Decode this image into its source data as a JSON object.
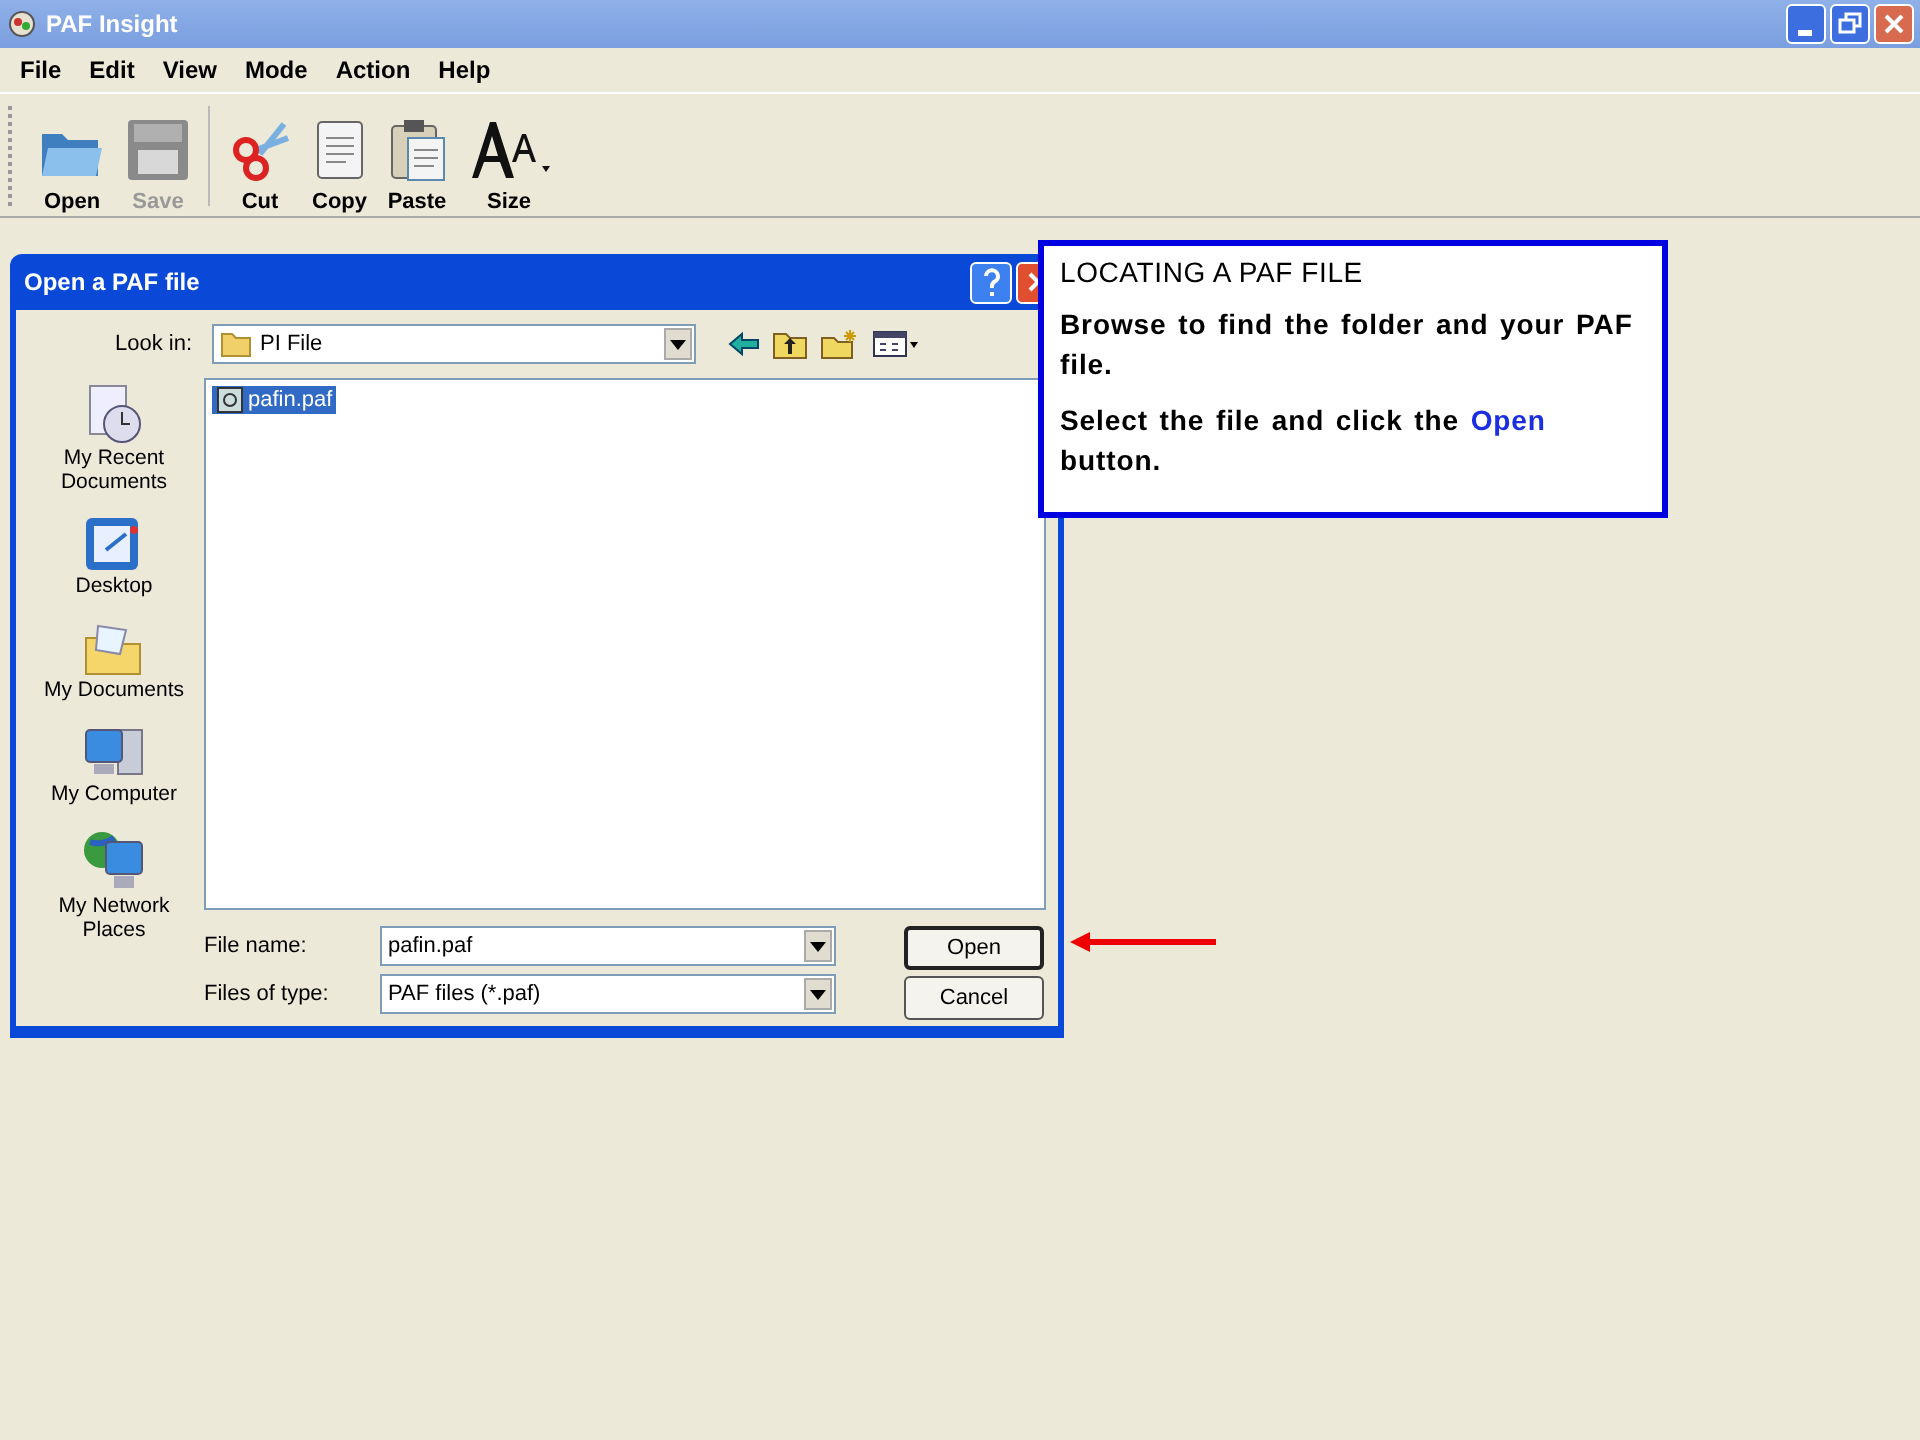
{
  "window": {
    "title": "PAF Insight"
  },
  "menu": [
    "File",
    "Edit",
    "View",
    "Mode",
    "Action",
    "Help"
  ],
  "toolbar": [
    {
      "label": "Open",
      "kind": "open",
      "disabled": false
    },
    {
      "label": "Save",
      "kind": "save",
      "disabled": true
    },
    {
      "label": "Cut",
      "kind": "cut",
      "disabled": false
    },
    {
      "label": "Copy",
      "kind": "copy",
      "disabled": false
    },
    {
      "label": "Paste",
      "kind": "paste",
      "disabled": false
    },
    {
      "label": "Size",
      "kind": "size",
      "disabled": false
    }
  ],
  "dialog": {
    "title": "Open a PAF file",
    "look_in_label": "Look in:",
    "look_in_value": "PI File",
    "places": [
      {
        "label": "My Recent Documents",
        "kind": "recent"
      },
      {
        "label": "Desktop",
        "kind": "desktop"
      },
      {
        "label": "My Documents",
        "kind": "documents"
      },
      {
        "label": "My Computer",
        "kind": "computer"
      },
      {
        "label": "My Network Places",
        "kind": "network"
      }
    ],
    "files": [
      {
        "name": "pafin.paf",
        "selected": true
      }
    ],
    "file_name_label": "File name:",
    "file_name_value": "pafin.paf",
    "file_type_label": "Files of type:",
    "file_type_value": "PAF files (*.paf)",
    "buttons": [
      "Open",
      "Cancel"
    ]
  },
  "callout": {
    "title": "LOCATING A PAF FILE",
    "paragraphs": [
      [
        {
          "text": "Browse to find the folder and your PAF file.",
          "kind": "plain"
        }
      ],
      [
        {
          "text": "Select the file and click the ",
          "kind": "plain"
        },
        {
          "text": "Open",
          "kind": "highlight"
        },
        {
          "text": " button.",
          "kind": "plain"
        }
      ]
    ]
  }
}
